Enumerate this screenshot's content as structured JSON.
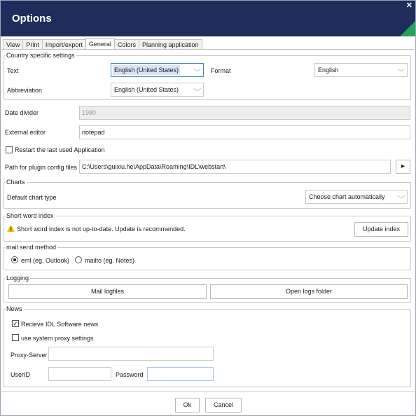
{
  "window": {
    "title": "Options",
    "close_glyph": "✕"
  },
  "tabs": [
    {
      "label": "View"
    },
    {
      "label": "Print"
    },
    {
      "label": "Import/export"
    },
    {
      "label": "General"
    },
    {
      "label": "Colors"
    },
    {
      "label": "Planning application"
    }
  ],
  "active_tab": "General",
  "country": {
    "legend": "Country specific settings",
    "text_label": "Text",
    "text_value": "English (United States)",
    "format_label": "Format",
    "format_value": "English",
    "abbreviation_label": "Abbreviation",
    "abbreviation_value": "English (United States)"
  },
  "date_divider": {
    "label": "Date divider",
    "value": "1980"
  },
  "external_editor": {
    "label": "External editor",
    "value": "notepad"
  },
  "restart": {
    "label": "Restart the last used Application",
    "checked": false
  },
  "plugin_path": {
    "label": "Path for plugin config files",
    "value": "C:\\Users\\guixiu.he\\AppData\\Roaming\\IDL\\webstart\\",
    "browse_glyph": "▸"
  },
  "charts": {
    "legend": "Charts",
    "label": "Default chart type",
    "value": "Choose chart automatically"
  },
  "short_word": {
    "legend": "Short word index",
    "warning": "Short word index is not up-to-date. Update is recommended.",
    "button": "Update index",
    "icon": "warning-icon"
  },
  "mail": {
    "legend": "mail send method",
    "option_eml": "eml (eg. Outlook)",
    "option_mailto": "mailto (eg. Notes)",
    "selected": "eml"
  },
  "logging": {
    "legend": "Logging",
    "mail_button": "Mail logfiles",
    "open_button": "Open logs folder"
  },
  "news": {
    "legend": "News",
    "receive_label": "Recieve IDL Software news",
    "receive_checked": true,
    "proxy_label": "use system proxy settings",
    "proxy_checked": false,
    "proxy_server_label": "Proxy-Server",
    "proxy_server_value": "",
    "userid_label": "UserID",
    "userid_value": "",
    "password_label": "Password",
    "password_value": ""
  },
  "footer": {
    "ok": "Ok",
    "cancel": "Cancel"
  },
  "colors": {
    "titlebar": "#1e2d5c",
    "accent_corner": "#27a15b",
    "warning": "#f2c200"
  }
}
